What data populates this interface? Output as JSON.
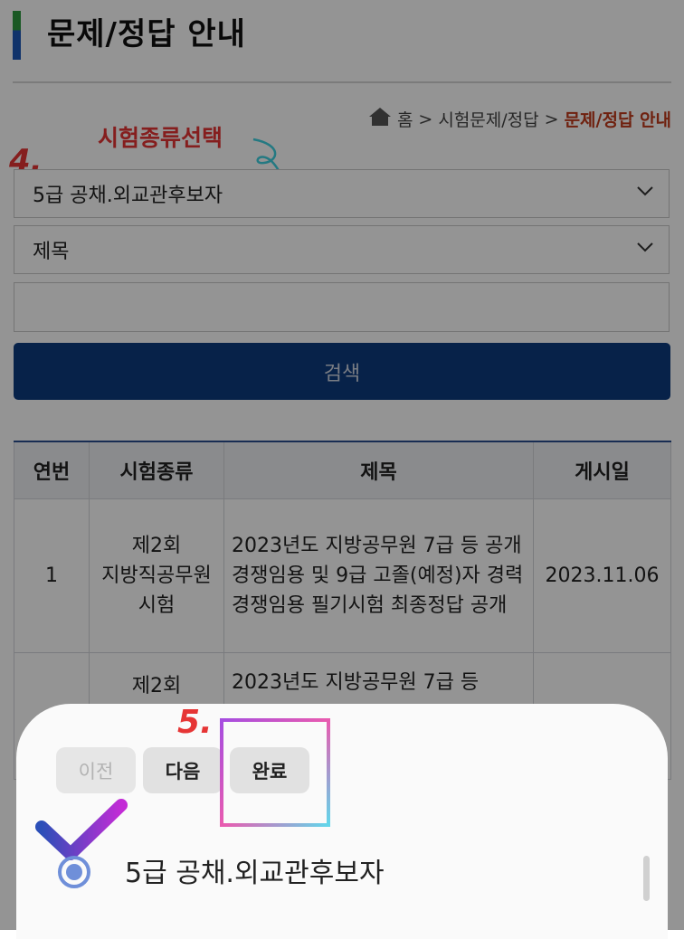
{
  "page_title": "문제/정답 안내",
  "breadcrumb": {
    "items": [
      "홈",
      "시험문제/정답"
    ],
    "separator": ">",
    "current": "문제/정답 안내"
  },
  "annotations": {
    "step4_label": "시험종류선택",
    "step4_number": "4.",
    "step5_number": "5."
  },
  "search_form": {
    "exam_type_selected": "5급 공채.외교관후보자",
    "field_selected": "제목",
    "keyword_value": "",
    "search_button": "검색"
  },
  "table": {
    "headers": [
      "연번",
      "시험종류",
      "제목",
      "게시일"
    ],
    "rows": [
      {
        "no": "1",
        "exam_type": "제2회\n지방직공무원\n시험",
        "title": "2023년도 지방공무원 7급 등 공개경쟁임용 및 9급 고졸(예정)자 경력경쟁임용 필기시험 최종정답 공개",
        "date": "2023.11.06"
      },
      {
        "no": "",
        "exam_type": "제2회",
        "title": "2023년도 지방공무원 7급 등",
        "date": ""
      }
    ]
  },
  "picker": {
    "prev_label": "이전",
    "next_label": "다음",
    "done_label": "완료",
    "options": [
      "5급 공채.외교관후보자"
    ]
  },
  "colors": {
    "primary": "#0d3b7e",
    "breadcrumb_current": "#c0391b",
    "annotation_red": "#e63535"
  }
}
